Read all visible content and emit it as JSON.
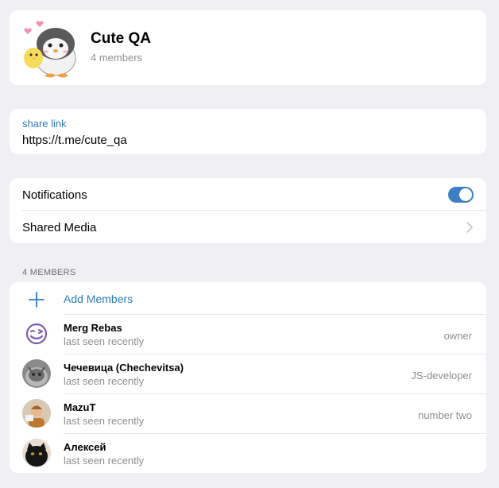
{
  "group": {
    "title": "Cute QA",
    "subtitle": "4 members"
  },
  "link": {
    "label": "share link",
    "url": "https://t.me/cute_qa"
  },
  "settings": {
    "notifications_label": "Notifications",
    "notifications_on": true,
    "shared_media_label": "Shared Media"
  },
  "members": {
    "section_header": "4 MEMBERS",
    "add_label": "Add Members",
    "list": [
      {
        "name": "Merg Rebas",
        "status": "last seen recently",
        "role": "owner",
        "avatar": "smiley-icon"
      },
      {
        "name": "Чечевица (Chechevitsa)",
        "status": "last seen recently",
        "role": "JS-developer",
        "avatar": "cat-photo"
      },
      {
        "name": "MazuT",
        "status": "last seen recently",
        "role": "number two",
        "avatar": "person-photo"
      },
      {
        "name": "Алексей",
        "status": "last seen recently",
        "role": "",
        "avatar": "black-cat-photo"
      }
    ]
  },
  "colors": {
    "accent": "#2f7bbf",
    "toggle_on": "#3d7fc4",
    "background": "#efeff4",
    "secondary_text": "#8e8e93",
    "smiley": "#7b5ea7"
  }
}
